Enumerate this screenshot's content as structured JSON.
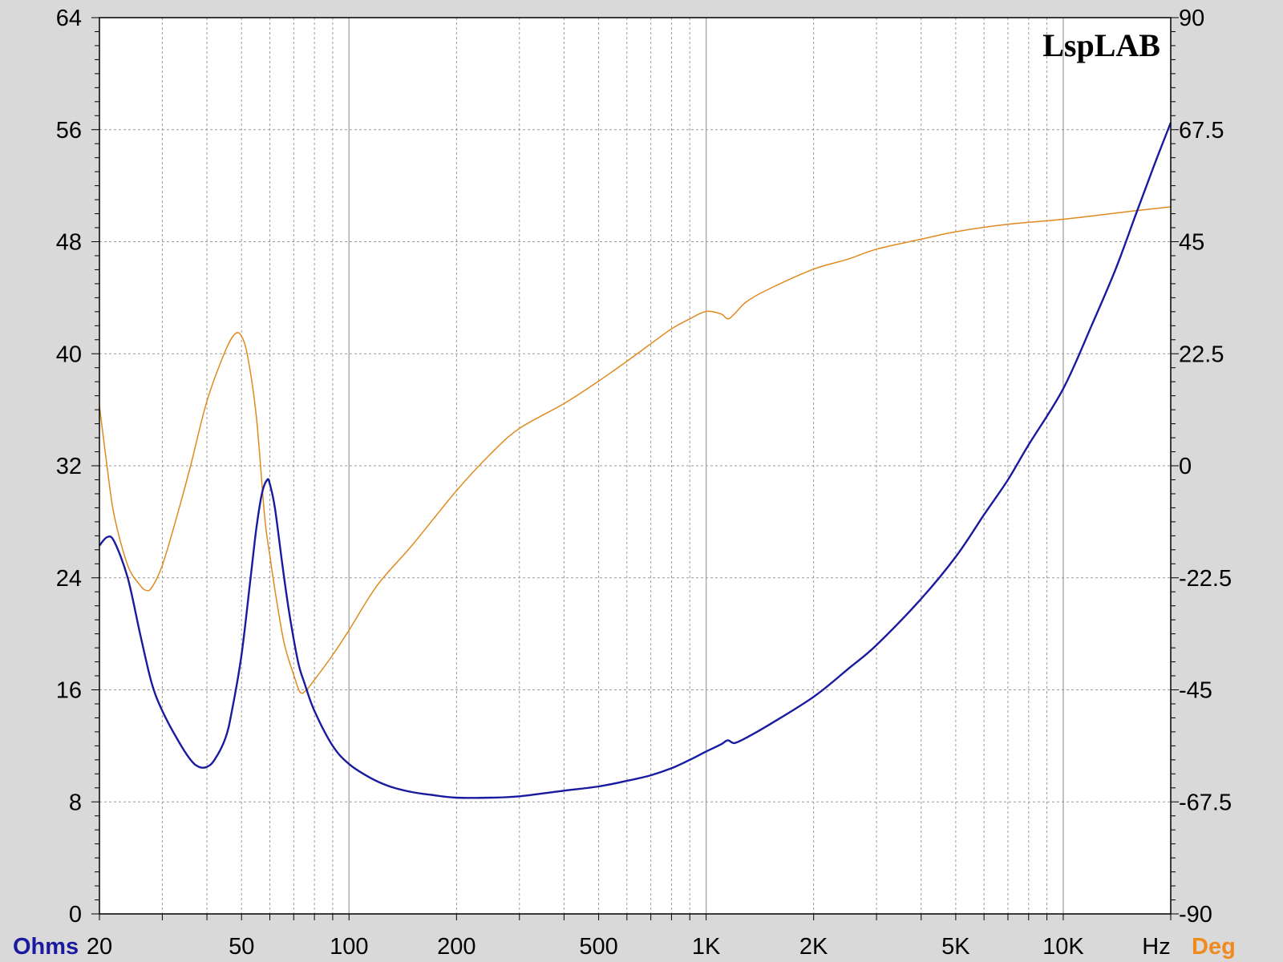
{
  "chart_data": {
    "type": "line",
    "x_scale": "log",
    "xlim": [
      20,
      20000
    ],
    "ylim_left": [
      0,
      64
    ],
    "ylim_right": [
      -90,
      90
    ],
    "grid": true,
    "watermark": "LspLAB",
    "left_axis_label": "Ohms",
    "right_axis_label": "Deg",
    "x_unit_label": "Hz",
    "x_ticks": [
      {
        "value": 20,
        "label": "20"
      },
      {
        "value": 50,
        "label": "50"
      },
      {
        "value": 100,
        "label": "100"
      },
      {
        "value": 200,
        "label": "200"
      },
      {
        "value": 500,
        "label": "500"
      },
      {
        "value": 1000,
        "label": "1K"
      },
      {
        "value": 2000,
        "label": "2K"
      },
      {
        "value": 5000,
        "label": "5K"
      },
      {
        "value": 10000,
        "label": "10K"
      }
    ],
    "y_left_ticks": [
      {
        "value": 0,
        "label": "0"
      },
      {
        "value": 8,
        "label": "8"
      },
      {
        "value": 16,
        "label": "16"
      },
      {
        "value": 24,
        "label": "24"
      },
      {
        "value": 32,
        "label": "32"
      },
      {
        "value": 40,
        "label": "40"
      },
      {
        "value": 48,
        "label": "48"
      },
      {
        "value": 56,
        "label": "56"
      },
      {
        "value": 64,
        "label": "64"
      }
    ],
    "y_right_ticks": [
      {
        "value": -90,
        "label": "-90"
      },
      {
        "value": -67.5,
        "label": "-67.5"
      },
      {
        "value": -45,
        "label": "-45"
      },
      {
        "value": -22.5,
        "label": "-22.5"
      },
      {
        "value": 0,
        "label": "0"
      },
      {
        "value": 22.5,
        "label": "22.5"
      },
      {
        "value": 45,
        "label": "45"
      },
      {
        "value": 67.5,
        "label": "67.5"
      },
      {
        "value": 90,
        "label": "90"
      }
    ],
    "series": [
      {
        "name": "",
        "axis": "left",
        "color": "#1a1aa0",
        "x": [
          20,
          21,
          22,
          24,
          26,
          28,
          30,
          33,
          36,
          38,
          40,
          42,
          45,
          47,
          50,
          53,
          55,
          57,
          59,
          60,
          62,
          65,
          68,
          72,
          75,
          80,
          90,
          100,
          115,
          130,
          150,
          170,
          200,
          250,
          300,
          400,
          500,
          600,
          700,
          800,
          900,
          1000,
          1100,
          1150,
          1200,
          1300,
          1500,
          2000,
          2500,
          3000,
          4000,
          5000,
          6000,
          7000,
          8000,
          10000,
          12000,
          14000,
          16000,
          18000,
          20000
        ],
        "y": [
          26.3,
          26.9,
          26.6,
          24.0,
          20.0,
          16.5,
          14.5,
          12.5,
          11.0,
          10.5,
          10.5,
          11.0,
          12.5,
          14.5,
          18.5,
          24.0,
          27.5,
          30.0,
          31.0,
          30.7,
          29.0,
          25.0,
          21.5,
          18.0,
          16.5,
          14.5,
          12.0,
          10.7,
          9.7,
          9.1,
          8.7,
          8.5,
          8.3,
          8.3,
          8.4,
          8.8,
          9.1,
          9.5,
          9.9,
          10.4,
          11.0,
          11.6,
          12.1,
          12.4,
          12.2,
          12.6,
          13.5,
          15.5,
          17.5,
          19.2,
          22.5,
          25.5,
          28.5,
          31.0,
          33.5,
          37.5,
          42.0,
          46.0,
          50.0,
          53.5,
          56.5
        ]
      },
      {
        "name": "",
        "axis": "right",
        "color": "#e08a1e",
        "x": [
          20,
          21,
          22,
          24,
          26,
          27,
          28,
          30,
          33,
          36,
          40,
          45,
          48,
          50,
          52,
          55,
          58,
          60,
          63,
          66,
          70,
          73,
          76,
          80,
          90,
          100,
          120,
          150,
          200,
          250,
          300,
          400,
          500,
          600,
          700,
          800,
          900,
          1000,
          1100,
          1150,
          1200,
          1300,
          1500,
          2000,
          2500,
          3000,
          4000,
          5000,
          7000,
          10000,
          15000,
          20000
        ],
        "y": [
          12.0,
          0.0,
          -10.0,
          -20.0,
          -24.0,
          -25.0,
          -24.5,
          -20.0,
          -10.0,
          0.0,
          13.0,
          23.0,
          26.5,
          26.0,
          22.0,
          10.0,
          -10.0,
          -18.0,
          -28.0,
          -36.0,
          -42.0,
          -45.5,
          -45.0,
          -43.0,
          -38.0,
          -33.0,
          -24.0,
          -16.0,
          -5.0,
          2.5,
          7.5,
          12.5,
          17.0,
          21.0,
          24.5,
          27.5,
          29.5,
          31.0,
          30.5,
          29.5,
          30.5,
          33.0,
          35.5,
          39.5,
          41.5,
          43.5,
          45.5,
          47.0,
          48.5,
          49.5,
          51.0,
          52.0
        ]
      }
    ]
  }
}
